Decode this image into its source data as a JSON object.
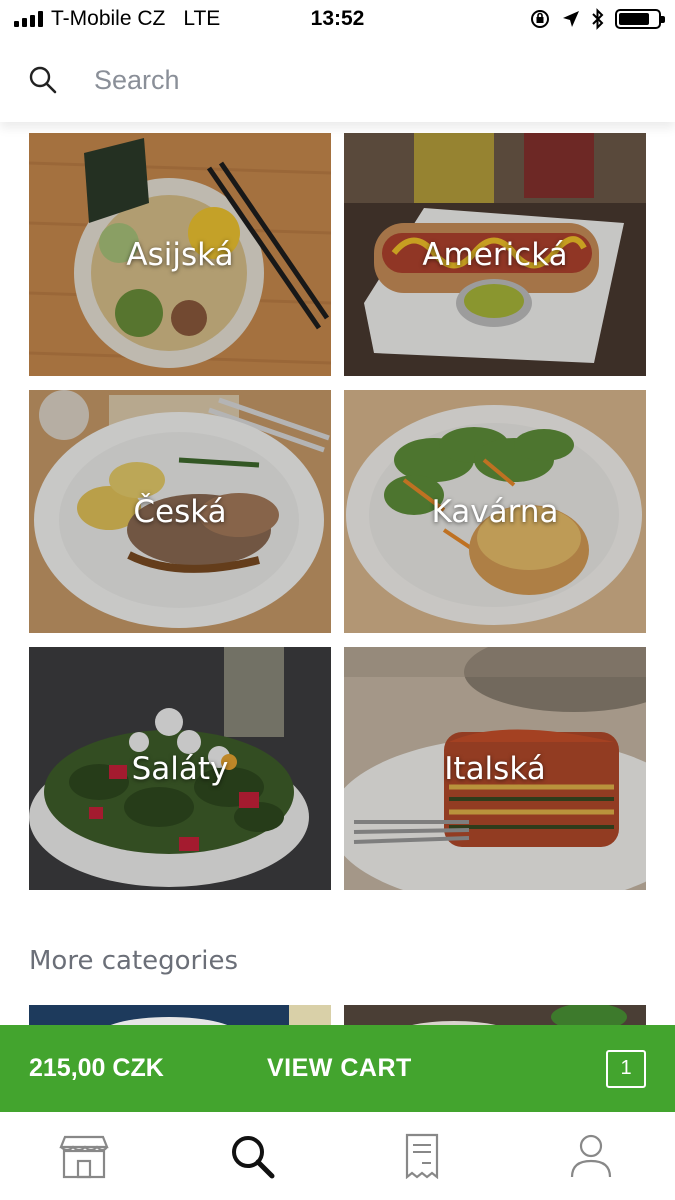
{
  "status_bar": {
    "carrier": "T-Mobile CZ",
    "network": "LTE",
    "time": "13:52"
  },
  "search": {
    "placeholder": "Search"
  },
  "categories": [
    {
      "label": "Asijská"
    },
    {
      "label": "Americká"
    },
    {
      "label": "Česká"
    },
    {
      "label": "Kavárna"
    },
    {
      "label": "Saláty"
    },
    {
      "label": "Italská"
    }
  ],
  "more_categories": {
    "title": "More categories"
  },
  "cart": {
    "total": "215,00 CZK",
    "label": "VIEW CART",
    "count": "1",
    "color": "#43a42e"
  },
  "tab_bar": {
    "items": [
      {
        "icon": "store-icon"
      },
      {
        "icon": "search-icon",
        "active": true
      },
      {
        "icon": "receipt-icon"
      },
      {
        "icon": "account-icon"
      }
    ]
  }
}
